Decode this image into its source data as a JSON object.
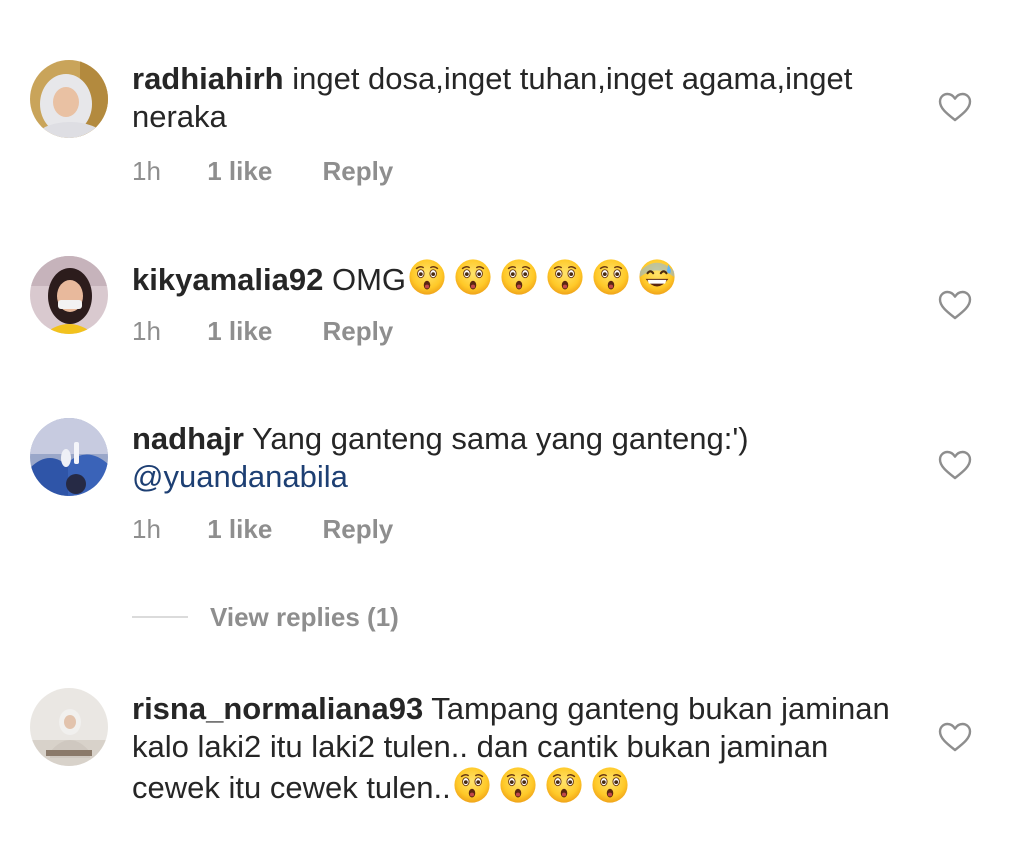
{
  "comments": [
    {
      "username": "radhiahirh",
      "text": "inget dosa,inget tuhan,inget agama,inget neraka",
      "time": "1h",
      "likes": "1 like",
      "reply": "Reply"
    },
    {
      "username": "kikyamalia92",
      "text": "OMG",
      "emojis": [
        "astonished-face",
        "astonished-face",
        "astonished-face",
        "astonished-face",
        "astonished-face",
        "grinning-face-with-sweat"
      ],
      "time": "1h",
      "likes": "1 like",
      "reply": "Reply"
    },
    {
      "username": "nadhajr",
      "text": "Yang ganteng sama yang ganteng:')",
      "mention": "@yuandanabila",
      "time": "1h",
      "likes": "1 like",
      "reply": "Reply",
      "view_replies": "View replies (1)"
    },
    {
      "username": "risna_normaliana93",
      "text": "Tampang ganteng bukan jaminan kalo laki2 itu laki2 tulen.. dan cantik bukan jaminan cewek itu cewek tulen..",
      "emojis": [
        "astonished-face",
        "astonished-face",
        "astonished-face",
        "astonished-face"
      ]
    }
  ],
  "icons": {
    "like": "heart-outline-icon"
  },
  "colors": {
    "text": "#262626",
    "secondary": "#8e8e8e",
    "mention": "#1d3f73",
    "divider": "#dbdbdb"
  }
}
